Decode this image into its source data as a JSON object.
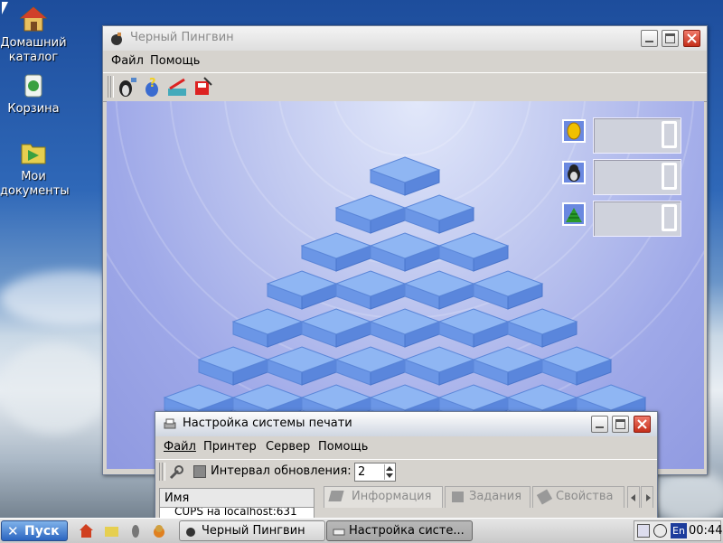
{
  "desktop": {
    "icons": [
      {
        "label": "Домашний каталог",
        "icon": "home-folder-icon"
      },
      {
        "label": "Корзина",
        "icon": "trash-icon"
      },
      {
        "label": "Мои документы",
        "icon": "documents-folder-icon"
      }
    ]
  },
  "game_window": {
    "title": "Черный Пингвин",
    "menu": [
      "Файл",
      "Помощь"
    ],
    "toolbar_icons": [
      "new-game-icon",
      "help-icon",
      "scores-icon",
      "save-icon"
    ],
    "scores": [
      {
        "icon": "coin-icon",
        "value": "0"
      },
      {
        "icon": "penguin-icon",
        "value": "0"
      },
      {
        "icon": "green-blocks-icon",
        "value": "0"
      }
    ],
    "pyramid_rows": 7
  },
  "print_window": {
    "title": "Настройка системы печати",
    "menu": [
      "Файл",
      "Принтер",
      "Сервер",
      "Помощь"
    ],
    "refresh_label": "Интервал обновления:",
    "refresh_value": "2",
    "list_header": "Имя",
    "list_item": "CUPS на localhost:631",
    "tabs": [
      "Информация",
      "Задания",
      "Свойства"
    ]
  },
  "taskbar": {
    "start_label": "Пуск",
    "tasks": [
      {
        "label": "Черный Пингвин",
        "active": false
      },
      {
        "label": "Настройка систе...",
        "active": true
      }
    ],
    "lang": "En",
    "clock": "00:44"
  },
  "colors": {
    "desktop_sky": "#2f68b8",
    "window_bg": "#d6d3ce",
    "cube_face": "#78a4ee",
    "game_bg": "#aab3ec",
    "start_button": "#2b65c0",
    "close_button": "#c42e1a"
  }
}
